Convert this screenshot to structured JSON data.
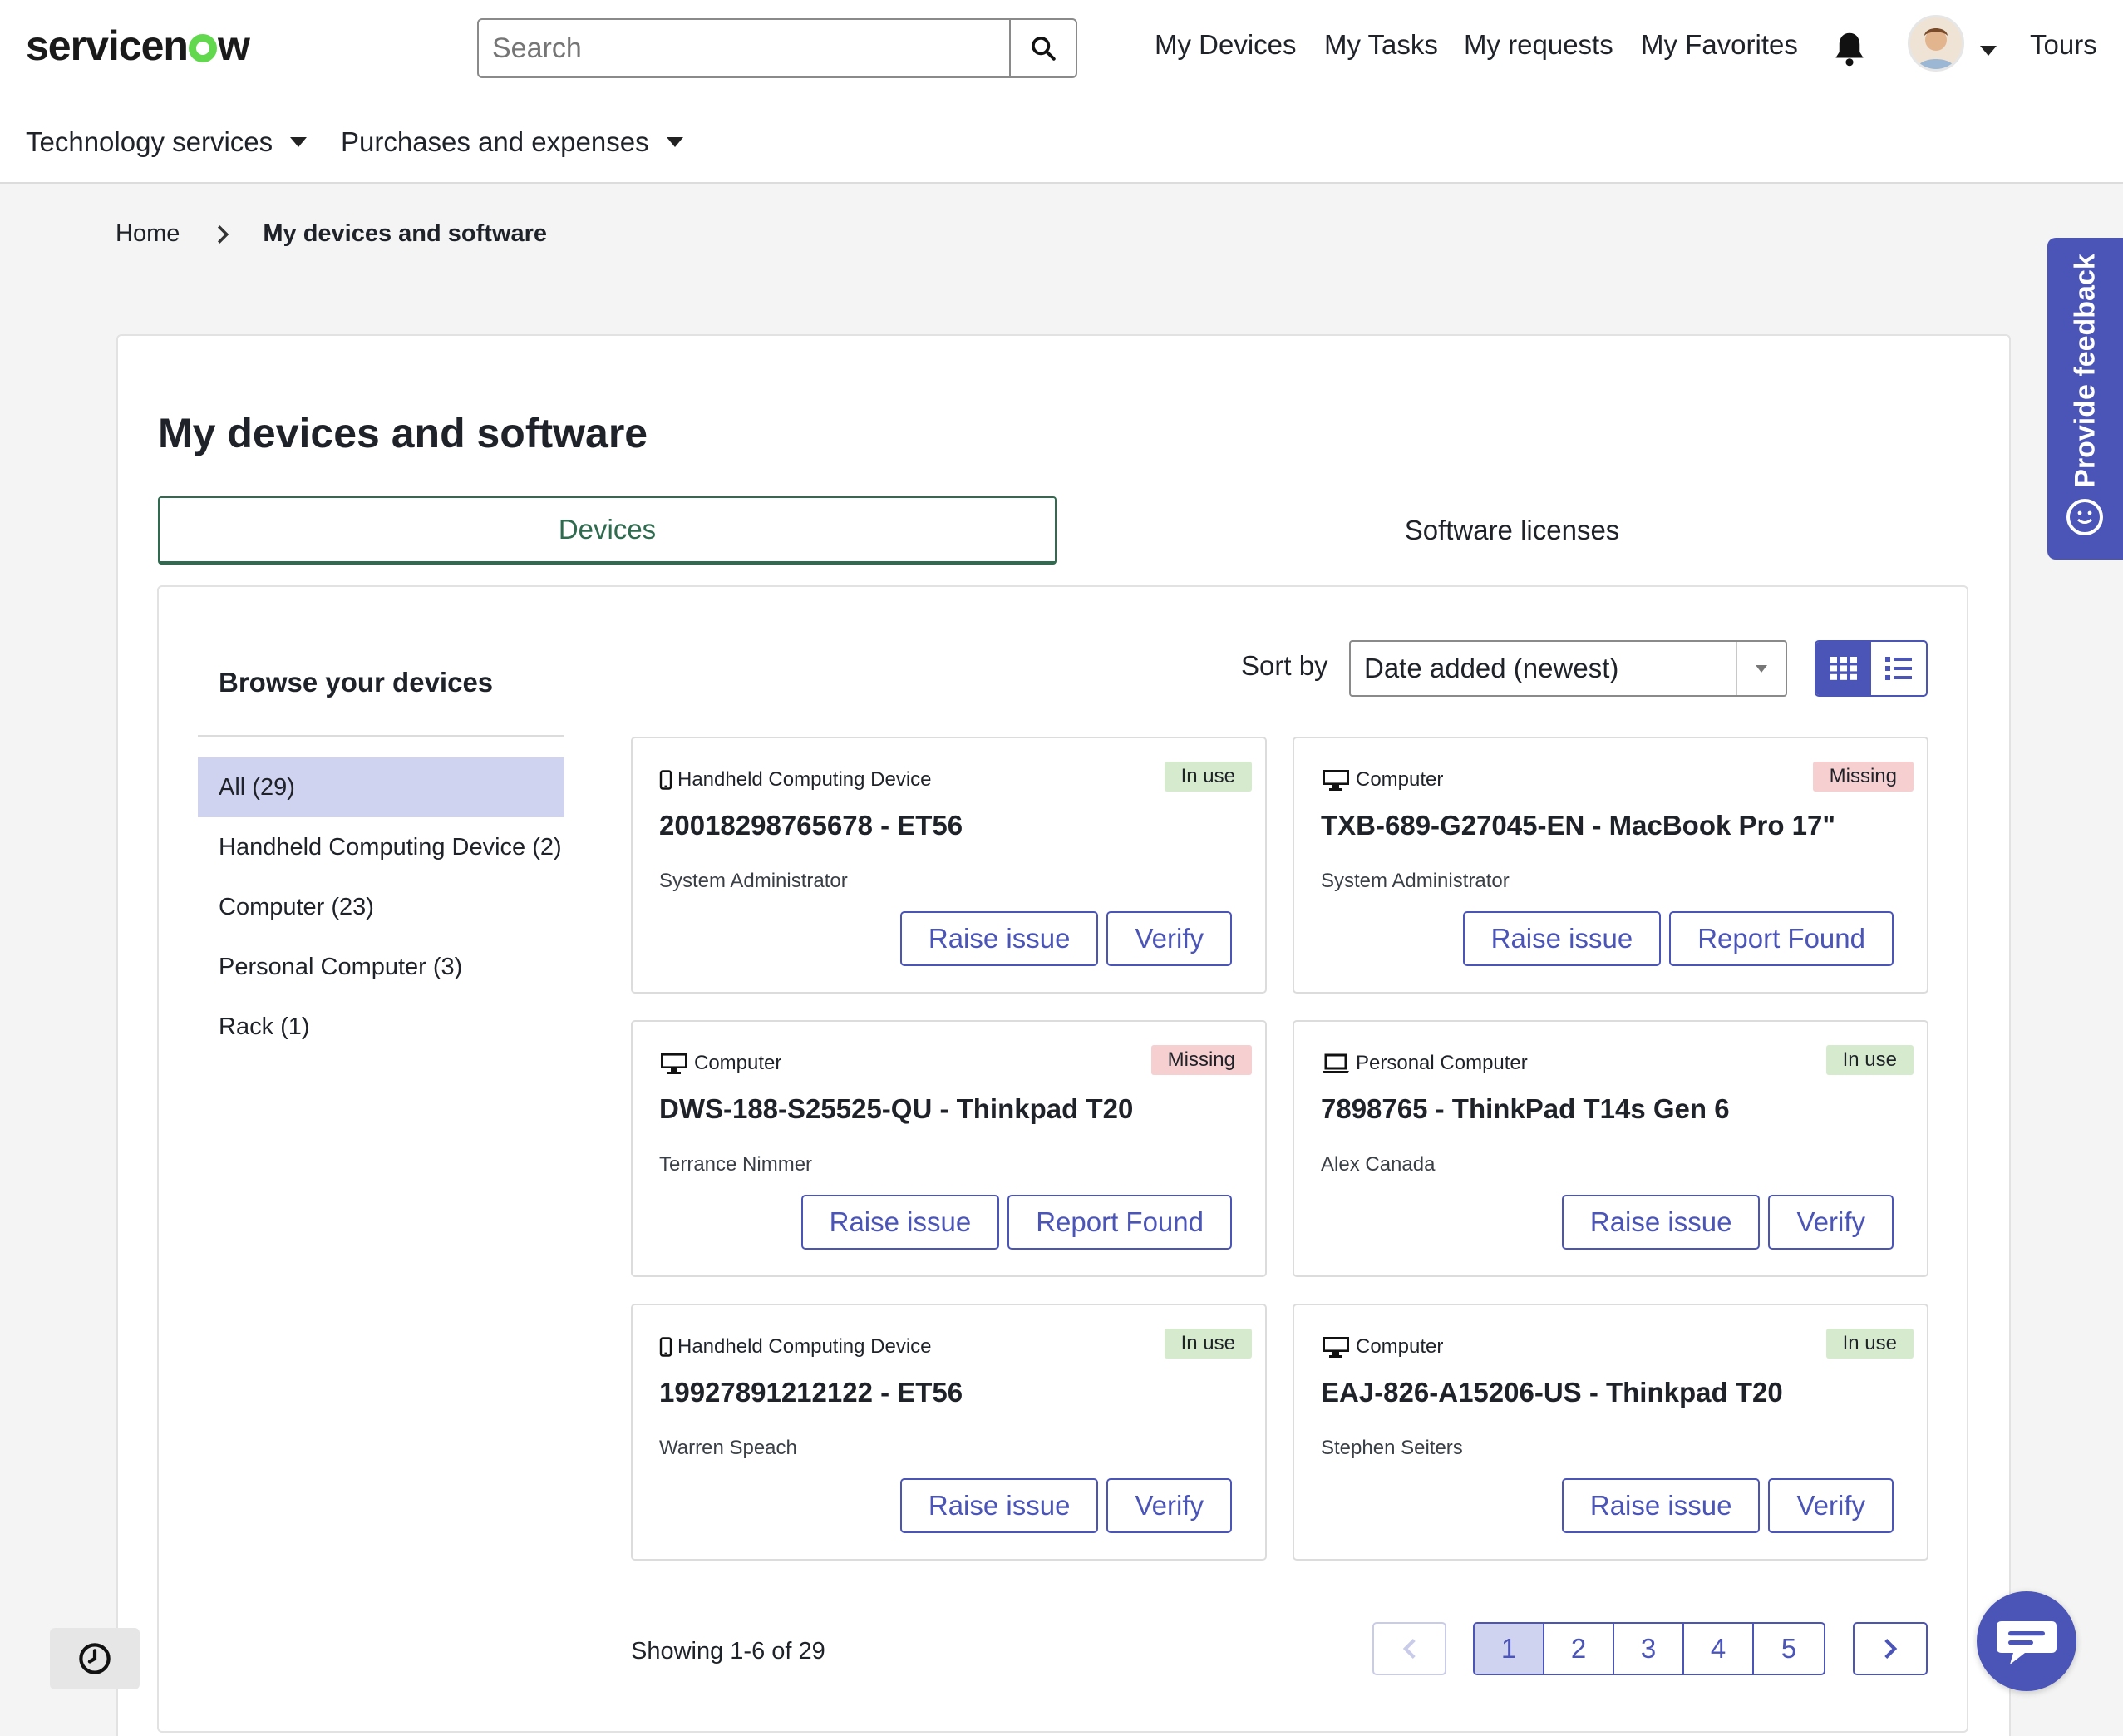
{
  "header": {
    "logo_text_left": "servicen",
    "logo_text_right": "w",
    "search_placeholder": "Search",
    "nav": [
      "My Devices",
      "My Tasks",
      "My requests",
      "My Favorites"
    ],
    "tours": "Tours"
  },
  "menu": {
    "items": [
      "Technology services",
      "Purchases and expenses"
    ]
  },
  "breadcrumb": {
    "home": "Home",
    "current": "My devices and software"
  },
  "page": {
    "title": "My devices and software",
    "tabs": [
      "Devices",
      "Software licenses"
    ]
  },
  "browse": {
    "title": "Browse your devices",
    "filters": [
      "All (29)",
      "Handheld Computing Device (2)",
      "Computer (23)",
      "Personal Computer (3)",
      "Rack (1)"
    ]
  },
  "sort": {
    "label": "Sort by",
    "value": "Date added (newest)"
  },
  "cards": [
    {
      "type": "Handheld Computing Device",
      "icon": "mobile-icon",
      "status": "In use",
      "name": "20018298765678 - ET56",
      "owner": "System Administrator",
      "buttons": [
        "Raise issue",
        "Verify"
      ]
    },
    {
      "type": "Computer",
      "icon": "monitor-icon",
      "status": "Missing",
      "name": "TXB-689-G27045-EN - MacBook Pro 17\"",
      "owner": "System Administrator",
      "buttons": [
        "Raise issue",
        "Report Found"
      ]
    },
    {
      "type": "Computer",
      "icon": "monitor-icon",
      "status": "Missing",
      "name": "DWS-188-S25525-QU - Thinkpad T20",
      "owner": "Terrance Nimmer",
      "buttons": [
        "Raise issue",
        "Report Found"
      ]
    },
    {
      "type": "Personal Computer",
      "icon": "laptop-icon",
      "status": "In use",
      "name": "7898765 - ThinkPad T14s Gen 6",
      "owner": "Alex Canada",
      "buttons": [
        "Raise issue",
        "Verify"
      ]
    },
    {
      "type": "Handheld Computing Device",
      "icon": "mobile-icon",
      "status": "In use",
      "name": "19927891212122 - ET56",
      "owner": "Warren Speach",
      "buttons": [
        "Raise issue",
        "Verify"
      ]
    },
    {
      "type": "Computer",
      "icon": "monitor-icon",
      "status": "In use",
      "name": "EAJ-826-A15206-US - Thinkpad T20",
      "owner": "Stephen Seiters",
      "buttons": [
        "Raise issue",
        "Verify"
      ]
    }
  ],
  "pagination": {
    "showing": "Showing 1-6 of 29",
    "pages": [
      "1",
      "2",
      "3",
      "4",
      "5"
    ],
    "current": "1"
  },
  "feedback": {
    "label": "Provide feedback"
  },
  "colors": {
    "accent": "#4b55b8",
    "tab_active": "#2e6b4f",
    "in_use_bg": "#d6ebcd",
    "missing_bg": "#f6cfd1",
    "logo_green": "#62d84e"
  }
}
